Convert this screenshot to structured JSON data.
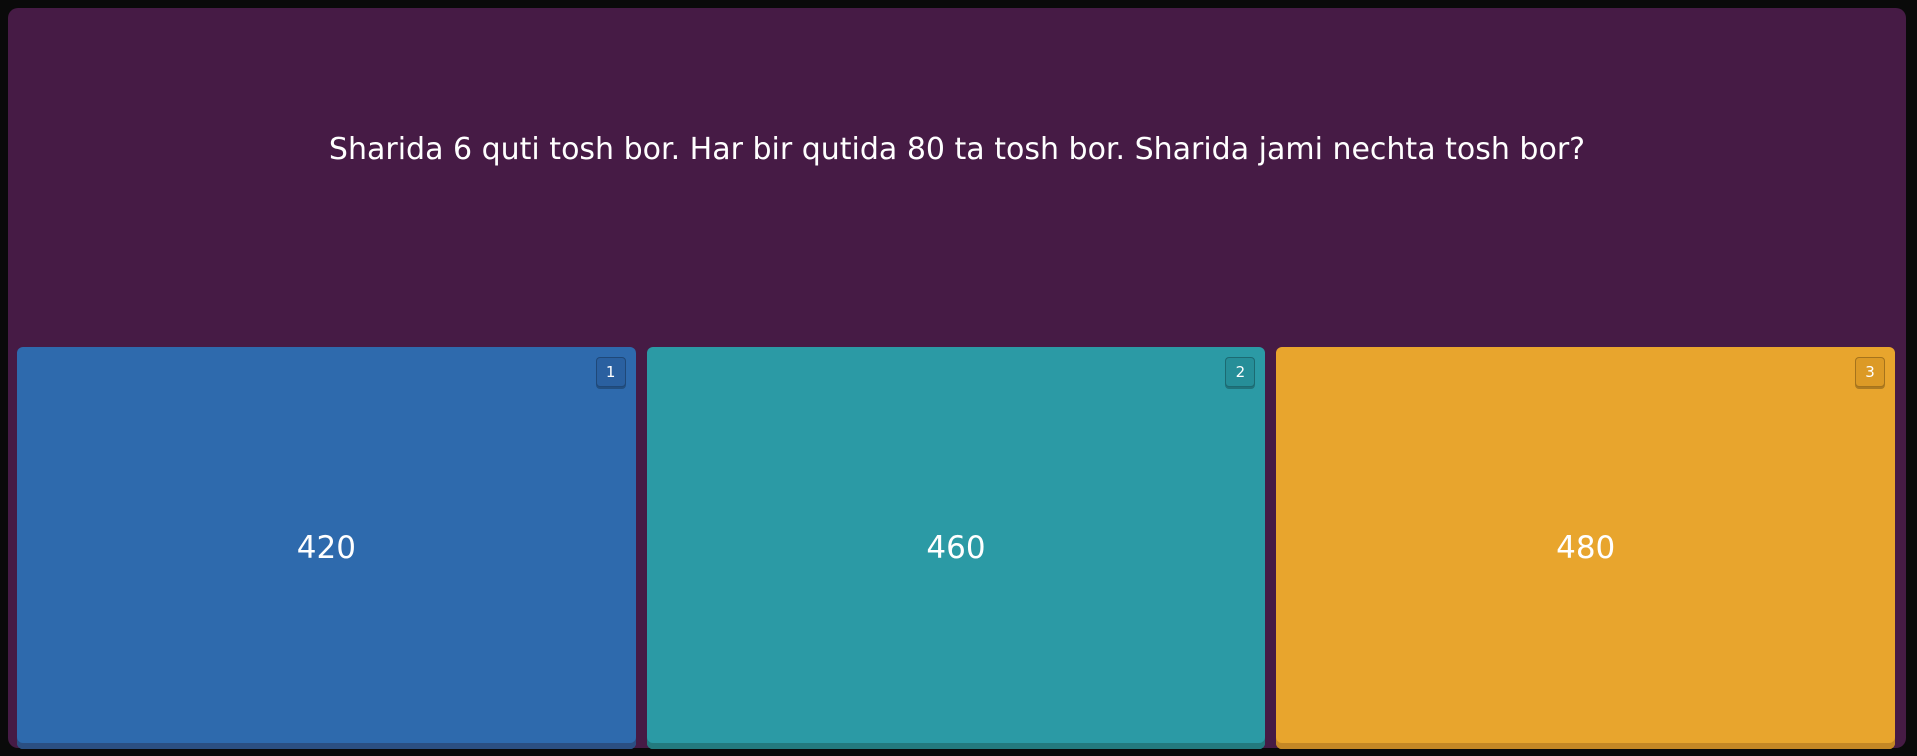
{
  "question": {
    "text": "Sharida 6 quti tosh bor. Har bir qutida 80 ta tosh bor. Sharida jami nechta tosh bor?"
  },
  "options": [
    {
      "key": "1",
      "value": "420",
      "color": "#2e6aad",
      "shadow": "#2b4f82",
      "badge": "#2a60a0"
    },
    {
      "key": "2",
      "value": "460",
      "color": "#2b9aa5",
      "shadow": "#237a7e",
      "badge": "#268e98"
    },
    {
      "key": "3",
      "value": "480",
      "color": "#e8a52d",
      "shadow": "#c48725",
      "badge": "#dc9a26"
    }
  ],
  "colors": {
    "frame_background": "#461b45",
    "page_background": "#0a0a0a"
  }
}
